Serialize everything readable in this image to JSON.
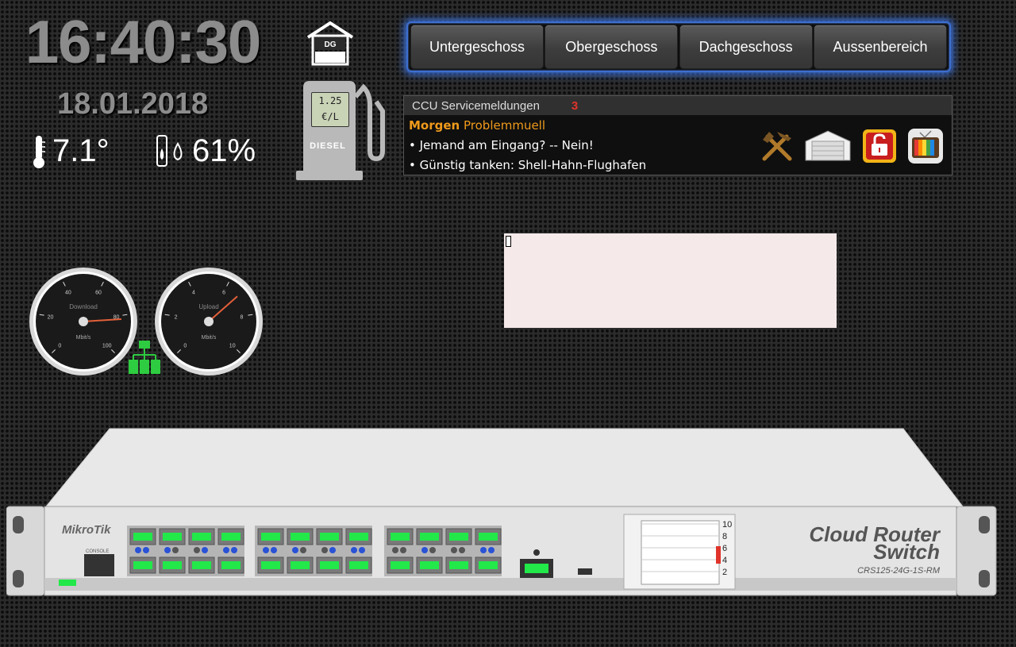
{
  "clock": {
    "time": "16:40:30",
    "date": "18.01.2018"
  },
  "weather": {
    "temperature": "7.1°",
    "humidity": "61%"
  },
  "house_icon": {
    "label": "DG"
  },
  "fuel": {
    "price": "1.25",
    "unit": "€/L",
    "label": "DIESEL"
  },
  "floors": [
    "Untergeschoss",
    "Obergeschoss",
    "Dachgeschoss",
    "Aussenbereich"
  ],
  "ccu": {
    "title": "CCU Servicemeldungen",
    "count": "3",
    "line1_bold": "Morgen",
    "line1_rest": "Problemmuell",
    "line2": "• Jemand am Eingang? -- Nein!",
    "line3": "• Günstig tanken: Shell-Hahn-Flughafen",
    "icons": [
      "hammer-pick-icon",
      "garage-icon",
      "unlocked-lock-icon",
      "tv-icon"
    ]
  },
  "gauges": [
    {
      "name": "Download",
      "unit": "Mbit/s",
      "ticks": [
        "0",
        "20",
        "40",
        "60",
        "80",
        "100"
      ],
      "value": 82
    },
    {
      "name": "Upload",
      "unit": "Mbit/s",
      "ticks": [
        "0",
        "2",
        "4",
        "6",
        "8",
        "10"
      ],
      "value": 6.8
    }
  ],
  "switch": {
    "brand": "MikroTik",
    "title_line1": "Cloud Router",
    "title_line2": "Switch",
    "model": "CRS125-24G-1S-RM",
    "console_label": "CONSOLE",
    "lcd_ticks": [
      "10",
      "8",
      "6",
      "4",
      "2"
    ]
  },
  "colors": {
    "accent": "#3d6fd0",
    "alert": "#e0342a",
    "orange": "#ef9a1b",
    "port_green": "#22e84a",
    "port_blue": "#2a52d6"
  }
}
